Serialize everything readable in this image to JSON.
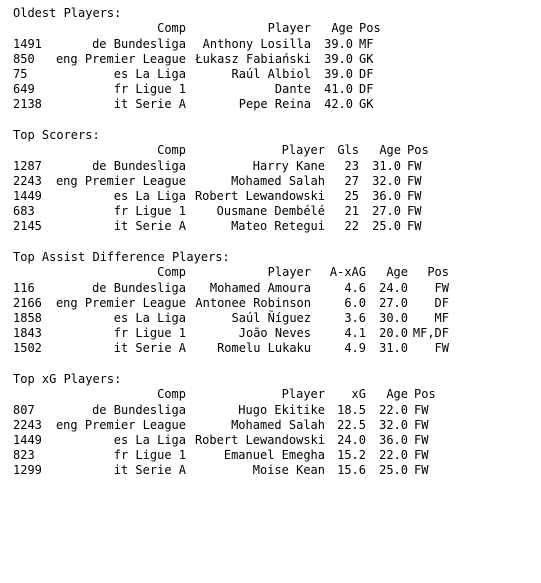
{
  "sections": [
    {
      "title": "Oldest Players:",
      "headers": [
        "Comp",
        "Player",
        "Age",
        "Pos"
      ],
      "rows": [
        [
          "1491",
          "de Bundesliga",
          "Anthony Losilla",
          "39.0",
          "MF"
        ],
        [
          "850",
          "eng Premier League",
          "Łukasz Fabiański",
          "39.0",
          "GK"
        ],
        [
          "75",
          "es La Liga",
          "Raúl Albiol",
          "39.0",
          "DF"
        ],
        [
          "649",
          "fr Ligue 1",
          "Dante",
          "41.0",
          "DF"
        ],
        [
          "2138",
          "it Serie A",
          "Pepe Reina",
          "42.0",
          "GK"
        ]
      ]
    },
    {
      "title": "Top Scorers:",
      "headers": [
        "Comp",
        "Player",
        "Gls",
        "Age",
        "Pos"
      ],
      "rows": [
        [
          "1287",
          "de Bundesliga",
          "Harry Kane",
          "23",
          "31.0",
          "FW"
        ],
        [
          "2243",
          "eng Premier League",
          "Mohamed Salah",
          "27",
          "32.0",
          "FW"
        ],
        [
          "1449",
          "es La Liga",
          "Robert Lewandowski",
          "25",
          "36.0",
          "FW"
        ],
        [
          "683",
          "fr Ligue 1",
          "Ousmane Dembélé",
          "21",
          "27.0",
          "FW"
        ],
        [
          "2145",
          "it Serie A",
          "Mateo Retegui",
          "22",
          "25.0",
          "FW"
        ]
      ]
    },
    {
      "title": "Top Assist Difference Players:",
      "headers": [
        "Comp",
        "Player",
        "A-xAG",
        "Age",
        "Pos"
      ],
      "rows": [
        [
          "116",
          "de Bundesliga",
          "Mohamed Amoura",
          "4.6",
          "24.0",
          "FW"
        ],
        [
          "2166",
          "eng Premier League",
          "Antonee Robinson",
          "6.0",
          "27.0",
          "DF"
        ],
        [
          "1858",
          "es La Liga",
          "Saúl Ñíguez",
          "3.6",
          "30.0",
          "MF"
        ],
        [
          "1843",
          "fr Ligue 1",
          "João Neves",
          "4.1",
          "20.0",
          "MF,DF"
        ],
        [
          "1502",
          "it Serie A",
          "Romelu Lukaku",
          "4.9",
          "31.0",
          "FW"
        ]
      ]
    },
    {
      "title": "Top xG Players:",
      "headers": [
        "Comp",
        "Player",
        "xG",
        "Age",
        "Pos"
      ],
      "rows": [
        [
          "807",
          "de Bundesliga",
          "Hugo Ekitike",
          "18.5",
          "22.0",
          "FW"
        ],
        [
          "2243",
          "eng Premier League",
          "Mohamed Salah",
          "22.5",
          "32.0",
          "FW"
        ],
        [
          "1449",
          "es La Liga",
          "Robert Lewandowski",
          "24.0",
          "36.0",
          "FW"
        ],
        [
          "823",
          "fr Ligue 1",
          "Emanuel Emegha",
          "15.2",
          "22.0",
          "FW"
        ],
        [
          "1299",
          "it Serie A",
          "Moise Kean",
          "15.6",
          "25.0",
          "FW"
        ]
      ]
    }
  ]
}
